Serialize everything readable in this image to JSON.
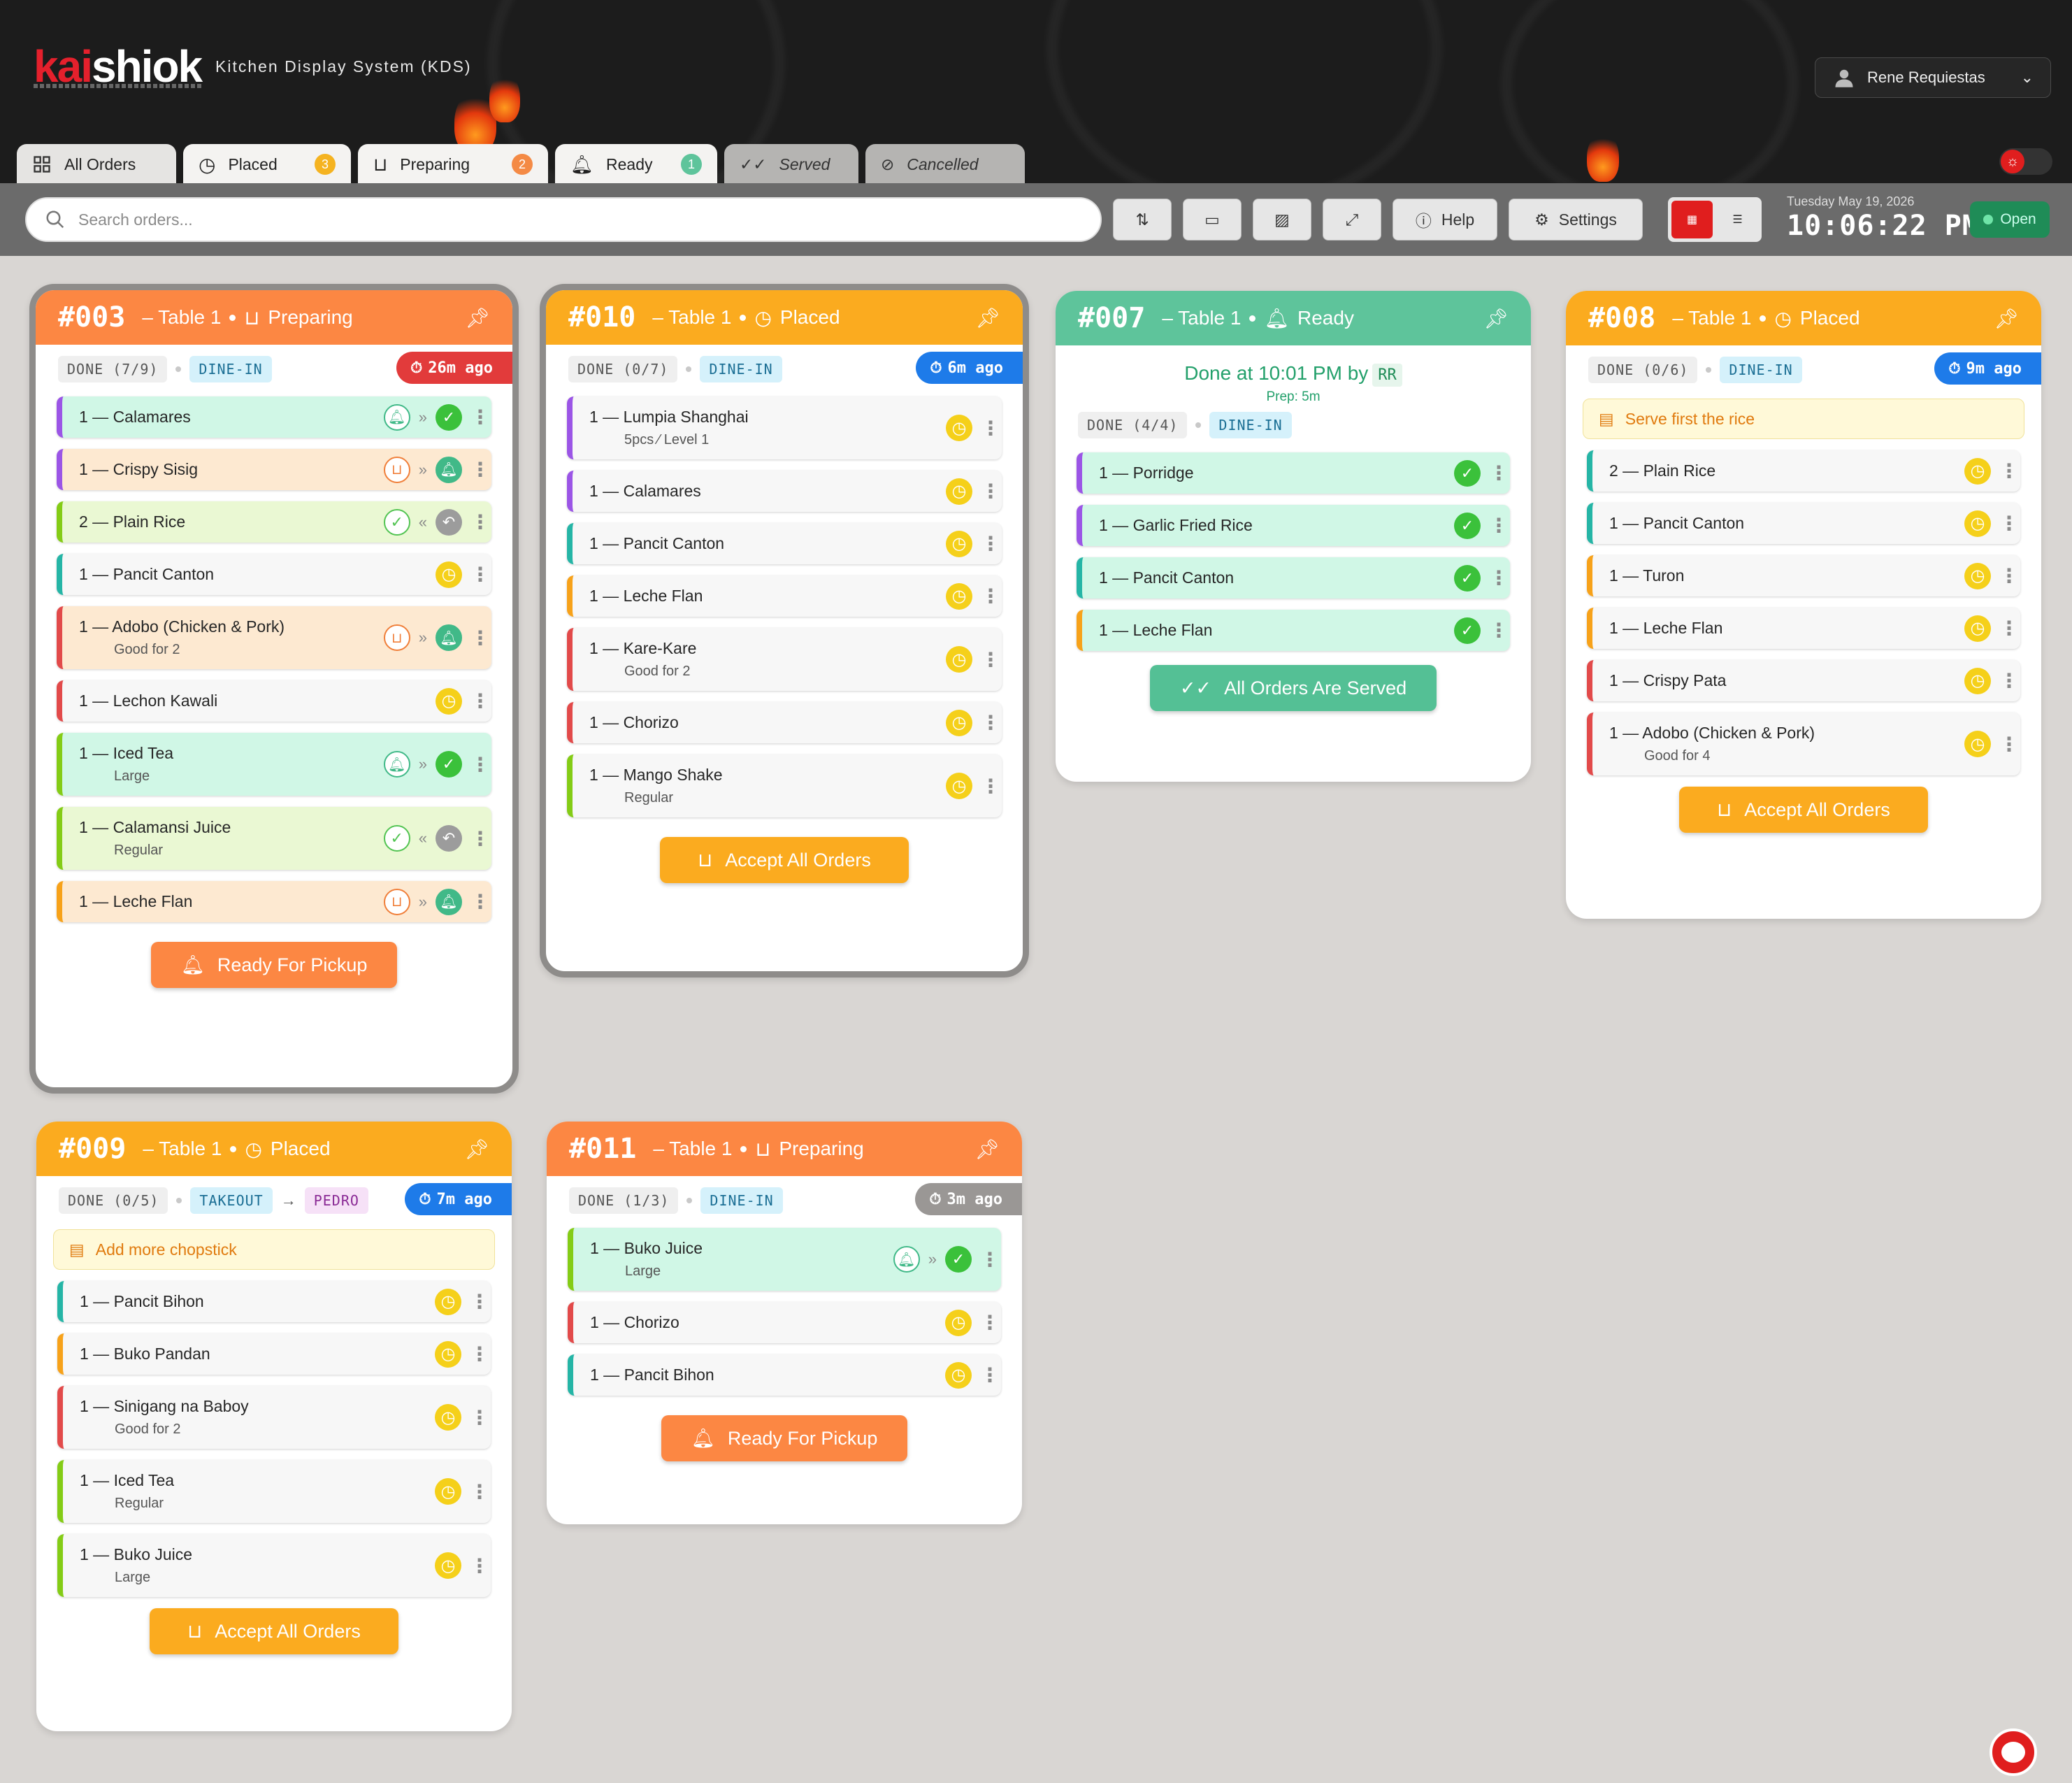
{
  "app": {
    "logo_red": "kai",
    "logo_white": "shiok",
    "title": "Kitchen Display System (KDS)",
    "user": "Rene Requiestas"
  },
  "tabs": [
    {
      "label": "All Orders",
      "count": null
    },
    {
      "label": "Placed",
      "count": "3"
    },
    {
      "label": "Preparing",
      "count": "2"
    },
    {
      "label": "Ready",
      "count": "1"
    },
    {
      "label": "Served",
      "count": null
    },
    {
      "label": "Cancelled",
      "count": null
    }
  ],
  "toolbar": {
    "search_placeholder": "Search orders...",
    "help": "Help",
    "settings": "Settings",
    "date": "Tuesday May 19, 2026",
    "time": "10:06:22 PM",
    "status": "Open"
  },
  "orders": {
    "o003": {
      "num": "#003",
      "table": "– Table 1",
      "status": "Preparing",
      "done": "DONE (7/9)",
      "type": "DINE-IN",
      "ago": "26m ago",
      "action": "Ready For Pickup",
      "items": [
        {
          "text": "1 — Calamares"
        },
        {
          "text": "1 — Crispy Sisig"
        },
        {
          "text": "2 — Plain Rice"
        },
        {
          "text": "1 — Pancit Canton"
        },
        {
          "text": "1 — Adobo (Chicken & Pork)",
          "sub": "Good for 2"
        },
        {
          "text": "1 — Lechon Kawali"
        },
        {
          "text": "1 — Iced Tea",
          "sub": "Large"
        },
        {
          "text": "1 — Calamansi Juice",
          "sub": "Regular"
        },
        {
          "text": "1 — Leche Flan"
        }
      ]
    },
    "o010": {
      "num": "#010",
      "table": "– Table 1",
      "status": "Placed",
      "done": "DONE (0/7)",
      "type": "DINE-IN",
      "ago": "6m ago",
      "action": "Accept All Orders",
      "items": [
        {
          "text": "1 — Lumpia Shanghai",
          "sub": "5pcs ⁄ Level 1"
        },
        {
          "text": "1 — Calamares"
        },
        {
          "text": "1 — Pancit Canton"
        },
        {
          "text": "1 — Leche Flan"
        },
        {
          "text": "1 — Kare-Kare",
          "sub": "Good for 2"
        },
        {
          "text": "1 — Chorizo"
        },
        {
          "text": "1 — Mango Shake",
          "sub": "Regular"
        }
      ]
    },
    "o007": {
      "num": "#007",
      "table": "– Table 1",
      "status": "Ready",
      "done_at": "Done at 10:01 PM by",
      "by": "RR",
      "prep": "Prep: 5m",
      "done": "DONE (4/4)",
      "type": "DINE-IN",
      "action": "All Orders Are Served",
      "items": [
        {
          "text": "1 — Porridge"
        },
        {
          "text": "1 — Garlic Fried Rice"
        },
        {
          "text": "1 — Pancit Canton"
        },
        {
          "text": "1 — Leche Flan"
        }
      ]
    },
    "o008": {
      "num": "#008",
      "table": "– Table 1",
      "status": "Placed",
      "done": "DONE (0/6)",
      "type": "DINE-IN",
      "ago": "9m ago",
      "note": "Serve first the rice",
      "action": "Accept All Orders",
      "items": [
        {
          "text": "2 — Plain Rice"
        },
        {
          "text": "1 — Pancit Canton"
        },
        {
          "text": "1 — Turon"
        },
        {
          "text": "1 — Leche Flan"
        },
        {
          "text": "1 — Crispy Pata"
        },
        {
          "text": "1 — Adobo (Chicken & Pork)",
          "sub": "Good for 4"
        }
      ]
    },
    "o009": {
      "num": "#009",
      "table": "– Table 1",
      "status": "Placed",
      "done": "DONE (0/5)",
      "type": "TAKEOUT",
      "customer": "PEDRO",
      "ago": "7m ago",
      "note": "Add more chopstick",
      "action": "Accept All Orders",
      "items": [
        {
          "text": "1 — Pancit Bihon"
        },
        {
          "text": "1 — Buko Pandan"
        },
        {
          "text": "1 — Sinigang na Baboy",
          "sub": "Good for 2"
        },
        {
          "text": "1 — Iced Tea",
          "sub": "Regular"
        },
        {
          "text": "1 — Buko Juice",
          "sub": "Large"
        }
      ]
    },
    "o011": {
      "num": "#011",
      "table": "– Table 1",
      "status": "Preparing",
      "done": "DONE (1/3)",
      "type": "DINE-IN",
      "ago": "3m ago",
      "action": "Ready For Pickup",
      "items": [
        {
          "text": "1 — Buko Juice",
          "sub": "Large"
        },
        {
          "text": "1 — Chorizo"
        },
        {
          "text": "1 — Pancit Bihon"
        }
      ]
    }
  },
  "colors": {
    "preparing": "#fc8743",
    "placed": "#fbab1f",
    "ready": "#5ec49b",
    "brand": "#e01e1e"
  }
}
